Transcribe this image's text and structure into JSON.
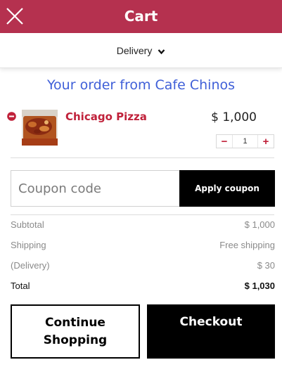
{
  "header": {
    "title": "Cart",
    "close_icon": "close-icon"
  },
  "delivery": {
    "label": "Delivery",
    "icon": "chevron-down-icon"
  },
  "order": {
    "title": "Your order from Cafe Chinos"
  },
  "cart_item": {
    "name": "Chicago Pizza",
    "price": "$ 1,000",
    "quantity": "1",
    "decrement": "−",
    "increment": "+"
  },
  "coupon": {
    "placeholder": "Coupon code",
    "button": "Apply coupon"
  },
  "totals": {
    "subtotal_label": "Subtotal",
    "subtotal_value": "$ 1,000",
    "shipping_label": "Shipping",
    "shipping_value": "Free shipping",
    "delivery_label": "(Delivery)",
    "delivery_value": "$ 30",
    "total_label": "Total",
    "total_value": "$ 1,030"
  },
  "actions": {
    "continue_line1": "Continue",
    "continue_line2": "Shopping",
    "checkout": "Checkout"
  },
  "colors": {
    "header": "#b5314f",
    "accent_red": "#c0213a",
    "title_blue": "#3f5fd8",
    "button_black": "#000000"
  }
}
